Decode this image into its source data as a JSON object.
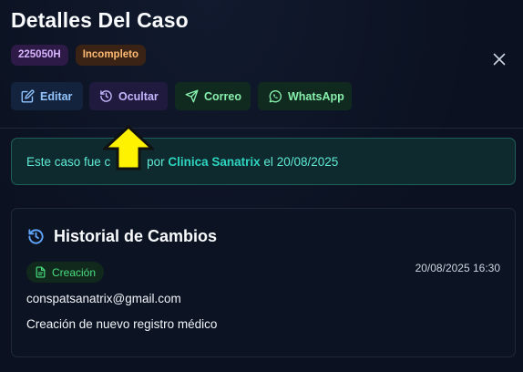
{
  "case": {
    "title": "Detalles Del Caso",
    "id_badge": "225050H",
    "status_badge": "Incompleto"
  },
  "actions": {
    "edit_label": "Editar",
    "hide_label": "Ocultar",
    "email_label": "Correo",
    "whatsapp_label": "WhatsApp"
  },
  "created_notice": {
    "prefix": "Este caso fue c",
    "by": "por",
    "author": "Clinica Sanatrix",
    "on": "el",
    "date": "20/08/2025"
  },
  "history": {
    "title": "Historial de Cambios",
    "entries": [
      {
        "type": "Creación",
        "timestamp": "20/08/2025 16:30",
        "user": "conspatsanatrix@gmail.com",
        "description": "Creación de nuevo registro médico"
      }
    ]
  },
  "colors": {
    "background": "#0b1120",
    "id_badge": "#d8b4fe",
    "status_badge": "#fdba74",
    "accent_teal": "#2dd4bf",
    "accent_green": "#4ade80",
    "cursor_yellow": "#fff200"
  },
  "icons": {
    "close": "close-icon",
    "edit": "edit-icon",
    "hide": "history-icon",
    "email": "send-icon",
    "whatsapp": "whatsapp-icon",
    "history": "history-icon",
    "entry": "document-icon",
    "pointer": "arrow-up-icon"
  }
}
